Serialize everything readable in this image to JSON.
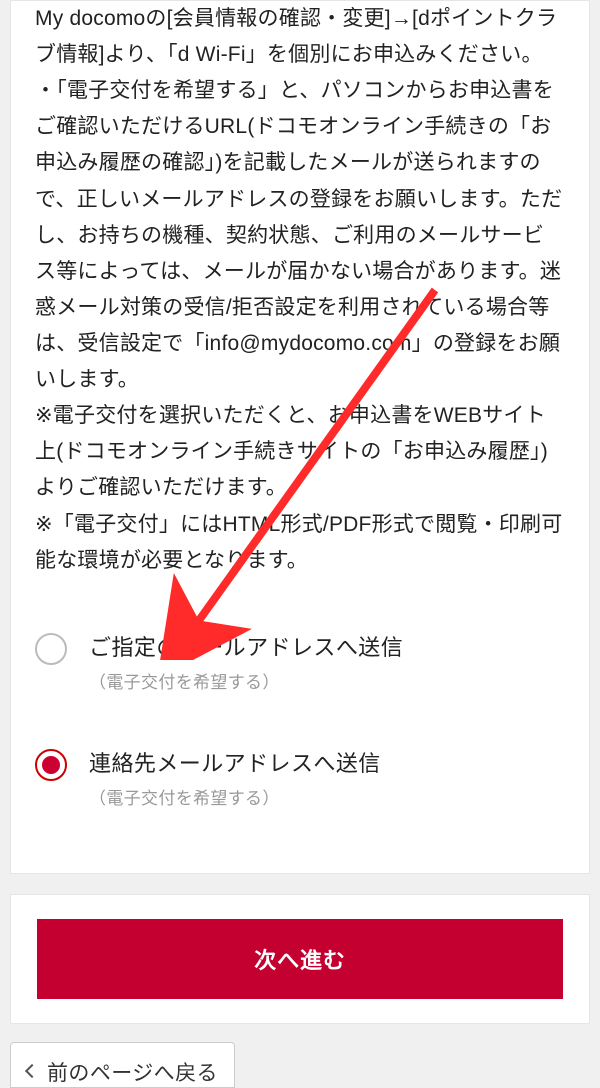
{
  "notice": {
    "p1": "My docomoの[会員情報の確認・変更]→[dポイントクラブ情報]より、「d Wi-Fi」を個別にお申込みください。",
    "p2": "・「電子交付を希望する」と、パソコンからお申込書をご確認いただけるURL(ドコモオンライン手続きの「お申込み履歴の確認」)を記載したメールが送られますので、正しいメールアドレスの登録をお願いします。ただし、お持ちの機種、契約状態、ご利用のメールサービス等によっては、メールが届かない場合があります。迷惑メール対策の受信/拒否設定を利用されている場合等は、受信設定で「info@mydocomo.com」の登録をお願いします。",
    "p3": "※電子交付を選択いただくと、お申込書をWEBサイト上(ドコモオンライン手続きサイトの「お申込み履歴」)よりご確認いただけます。",
    "p4": "※「電子交付」にはHTML形式/PDF形式で閲覧・印刷可能な環境が必要となります。"
  },
  "options": [
    {
      "label": "ご指定のメールアドレスへ送信",
      "hint": "（電子交付を希望する）",
      "selected": false
    },
    {
      "label": "連絡先メールアドレスへ送信",
      "hint": "（電子交付を希望する）",
      "selected": true
    }
  ],
  "buttons": {
    "next": "次へ進む",
    "back": "前のページへ戻る"
  },
  "colors": {
    "brand_red": "#c3002f"
  }
}
